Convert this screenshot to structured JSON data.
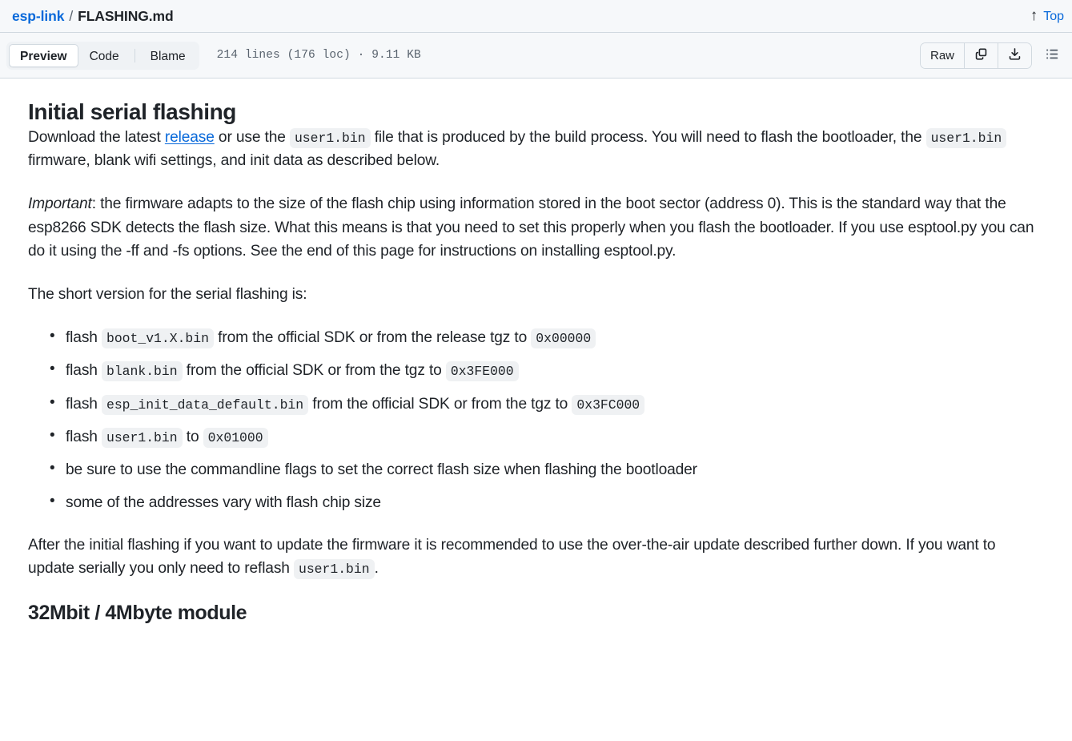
{
  "breadcrumb": {
    "repo": "esp-link",
    "separator": "/",
    "file": "FLASHING.md"
  },
  "back_to_top": {
    "arrow": "↑",
    "label": "Top"
  },
  "toolbar": {
    "tabs": [
      {
        "label": "Preview",
        "selected": true
      },
      {
        "label": "Code",
        "selected": false
      },
      {
        "label": "Blame",
        "selected": false
      }
    ],
    "file_meta": "214 lines (176 loc) · 9.11 KB",
    "raw_label": "Raw",
    "copy_icon": "copy-icon",
    "download_icon": "download-icon",
    "outline_icon": "outline-list-icon"
  },
  "colors": {
    "link": "#0969da",
    "text": "#1f2328",
    "muted": "#59636e",
    "surface": "#f6f8fa",
    "border": "#d1d9e0",
    "code_bg": "#eff1f3"
  },
  "content": {
    "heading_initial": "Initial serial flashing",
    "p1": {
      "t1": "Download the latest ",
      "link": "release",
      "t2": " or use the ",
      "code1": "user1.bin",
      "t3": " file that is produced by the build process. You will need to flash the bootloader, the ",
      "code2": "user1.bin",
      "t4": " firmware, blank wifi settings, and init data as described below."
    },
    "p2": {
      "em": "Important",
      "text": ": the firmware adapts to the size of the flash chip using information stored in the boot sector (address 0). This is the standard way that the esp8266 SDK detects the flash size. What this means is that you need to set this properly when you flash the bootloader. If you use esptool.py you can do it using the -ff and -fs options. See the end of this page for instructions on installing esptool.py."
    },
    "p3": "The short version for the serial flashing is:",
    "list": [
      {
        "t1": "flash ",
        "code1": "boot_v1.X.bin",
        "t2": " from the official SDK or from the release tgz to ",
        "code2": "0x00000",
        "t3": ""
      },
      {
        "t1": "flash ",
        "code1": "blank.bin",
        "t2": " from the official SDK or from the tgz to ",
        "code2": "0x3FE000",
        "t3": ""
      },
      {
        "t1": "flash ",
        "code1": "esp_init_data_default.bin",
        "t2": " from the official SDK or from the tgz to ",
        "code2": "0x3FC000",
        "t3": ""
      },
      {
        "t1": "flash ",
        "code1": "user1.bin",
        "t2": " to ",
        "code2": "0x01000",
        "t3": ""
      },
      {
        "t1": "be sure to use the commandline flags to set the correct flash size when flashing the bootloader",
        "code1": "",
        "t2": "",
        "code2": "",
        "t3": ""
      },
      {
        "t1": "some of the addresses vary with flash chip size",
        "code1": "",
        "t2": "",
        "code2": "",
        "t3": ""
      }
    ],
    "p4": {
      "t1": "After the initial flashing if you want to update the firmware it is recommended to use the over-the-air update described further down. If you want to update serially you only need to reflash ",
      "code1": "user1.bin",
      "t2": "."
    },
    "heading_module": "32Mbit / 4Mbyte module"
  }
}
